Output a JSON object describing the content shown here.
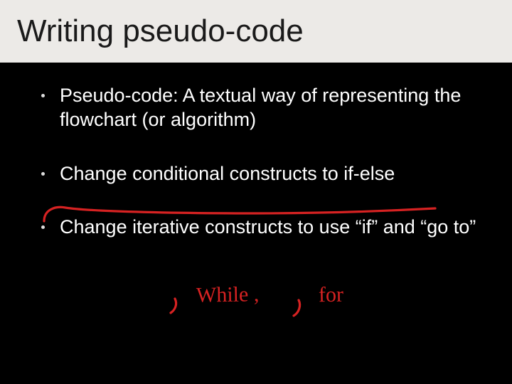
{
  "slide": {
    "title": "Writing pseudo-code",
    "bullets": [
      "Pseudo-code: A textual way of representing the flowchart (or algorithm)",
      "Change conditional constructs to if-else",
      "Change iterative constructs to use “if” and “go to”"
    ],
    "annotations": {
      "handwritten1": ",",
      "handwritten2": "While ,",
      "handwritten3": "for"
    }
  }
}
